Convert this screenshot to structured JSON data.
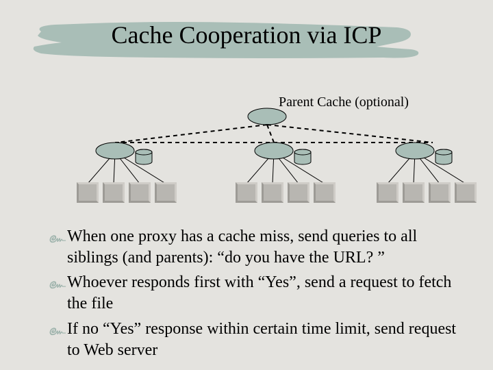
{
  "title": "Cache Cooperation via ICP",
  "captions": {
    "parent_cache": "Parent Cache (optional)"
  },
  "bullets": [
    "When one proxy has a cache miss, send queries to all siblings (and parents): “do you have the URL? ”",
    "Whoever responds first with “Yes”, send a request to fetch the file",
    "If no “Yes” response within certain time limit, send request to Web server"
  ],
  "diagram": {
    "type": "hierarchy",
    "description": "One optional parent cache above three sibling proxy caches, each with a cylinder (disk) beside it, and each serving four client boxes. Dashed lines connect parent to siblings and siblings to each other; solid lines connect proxies to clients.",
    "parent": {
      "label": "Parent Cache (optional)"
    },
    "siblings": 3,
    "clients_per_sibling": 4
  }
}
